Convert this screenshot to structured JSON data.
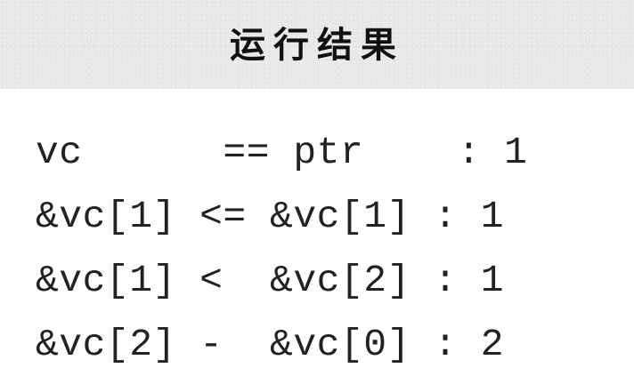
{
  "header": {
    "title": "运行结果"
  },
  "output": {
    "lines": [
      "vc      == ptr    : 1",
      "&vc[1] <= &vc[1] : 1",
      "&vc[1] <  &vc[2] : 1",
      "&vc[2] -  &vc[0] : 2"
    ]
  }
}
